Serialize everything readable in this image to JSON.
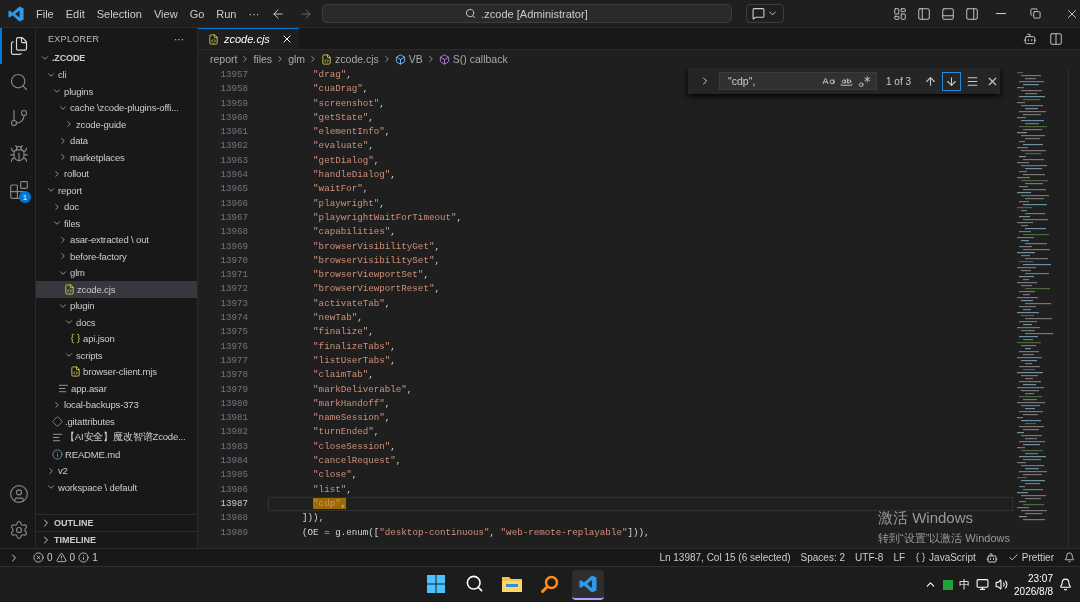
{
  "title_bar": {
    "menus": [
      "File",
      "Edit",
      "Selection",
      "View",
      "Go",
      "Run",
      "···"
    ],
    "command_center": ".zcode [Administrator]"
  },
  "activity_bar": {
    "items": [
      {
        "kind": "explorer",
        "selected": true
      },
      {
        "kind": "search",
        "selected": false
      },
      {
        "kind": "source-control",
        "selected": false
      },
      {
        "kind": "run",
        "selected": false
      },
      {
        "kind": "extensions",
        "selected": false,
        "badge": "1"
      }
    ],
    "bottom": [
      {
        "kind": "account"
      },
      {
        "kind": "settings"
      }
    ]
  },
  "sidebar": {
    "title": "EXPLORER",
    "more": "···",
    "root": {
      "label": ".ZCODE",
      "kind": "folder",
      "expanded": true,
      "selected": false,
      "children": [
        {
          "label": "cli",
          "kind": "folder",
          "expanded": true,
          "selected": false,
          "children": [
            {
              "label": "plugins",
              "kind": "folder",
              "expanded": true,
              "selected": false,
              "children": [
                {
                  "label": "cache \\zcode-plugins-offi...",
                  "kind": "folder",
                  "expanded": true,
                  "selected": false,
                  "children": [
                    {
                      "label": "zcode-guide",
                      "kind": "folder",
                      "expanded": false,
                      "selected": false
                    }
                  ]
                },
                {
                  "label": "data",
                  "kind": "folder",
                  "expanded": false,
                  "selected": false
                },
                {
                  "label": "marketplaces",
                  "kind": "folder",
                  "expanded": false,
                  "selected": false
                }
              ]
            },
            {
              "label": "rollout",
              "kind": "folder",
              "expanded": false,
              "selected": false
            }
          ]
        },
        {
          "label": "report",
          "kind": "folder",
          "expanded": true,
          "selected": false,
          "children": [
            {
              "label": "doc",
              "kind": "folder",
              "expanded": false,
              "selected": false
            },
            {
              "label": "files",
              "kind": "folder",
              "expanded": true,
              "selected": false,
              "children": [
                {
                  "label": "asar-extracted \\ out",
                  "kind": "folder",
                  "expanded": false,
                  "selected": false
                },
                {
                  "label": "before-factory",
                  "kind": "folder",
                  "expanded": false,
                  "selected": false
                },
                {
                  "label": "glm",
                  "kind": "folder",
                  "expanded": true,
                  "selected": false,
                  "children": [
                    {
                      "label": "zcode.cjs",
                      "kind": "js",
                      "selected": true
                    }
                  ]
                },
                {
                  "label": "plugin",
                  "kind": "folder",
                  "expanded": true,
                  "selected": false,
                  "children": [
                    {
                      "label": "docs",
                      "kind": "folder",
                      "expanded": true,
                      "selected": false,
                      "children": [
                        {
                          "label": "api.json",
                          "kind": "json",
                          "selected": false
                        }
                      ]
                    },
                    {
                      "label": "scripts",
                      "kind": "folder",
                      "expanded": true,
                      "selected": false,
                      "children": [
                        {
                          "label": "browser-client.mjs",
                          "kind": "js",
                          "selected": false
                        }
                      ]
                    }
                  ]
                },
                {
                  "label": "app.asar",
                  "kind": "file",
                  "selected": false
                }
              ]
            },
            {
              "label": "local-backups-373",
              "kind": "folder",
              "expanded": false,
              "selected": false
            },
            {
              "label": ".gitattributes",
              "kind": "git",
              "selected": false
            },
            {
              "label": "【AI安全】魔改智谱Zcode...",
              "kind": "file",
              "selected": false
            },
            {
              "label": "README.md",
              "kind": "info",
              "selected": false
            }
          ]
        },
        {
          "label": "v2",
          "kind": "folder",
          "expanded": false,
          "selected": false
        },
        {
          "label": "workspace \\ default",
          "kind": "folder",
          "expanded": true,
          "selected": false
        }
      ]
    },
    "sections": [
      {
        "label": "OUTLINE",
        "expanded": false
      },
      {
        "label": "TIMELINE",
        "expanded": false
      }
    ]
  },
  "tabs": [
    {
      "label": "zcode.cjs",
      "kind": "js",
      "selected": true,
      "preview": true
    }
  ],
  "breadcrumbs": [
    {
      "label": "report",
      "kind": "folder"
    },
    {
      "label": "files",
      "kind": "folder"
    },
    {
      "label": "glm",
      "kind": "folder"
    },
    {
      "label": "zcode.cjs",
      "kind": "js"
    },
    {
      "label": "VB",
      "kind": "variable"
    },
    {
      "label": "S() callback",
      "kind": "method"
    }
  ],
  "find_widget": {
    "value": "\"cdp\",",
    "options": [
      {
        "kind": "match-case",
        "on": false
      },
      {
        "kind": "whole-word",
        "on": false
      },
      {
        "kind": "regex",
        "on": false
      }
    ],
    "result": "1 of 3"
  },
  "editor": {
    "lines": [
      {
        "number": "13957",
        "text": "        \"drag\",",
        "selected": false
      },
      {
        "number": "13958",
        "text": "        \"cuaDrag\",",
        "selected": false
      },
      {
        "number": "13959",
        "text": "        \"screenshot\",",
        "selected": false
      },
      {
        "number": "13960",
        "text": "        \"getState\",",
        "selected": false
      },
      {
        "number": "13961",
        "text": "        \"elementInfo\",",
        "selected": false
      },
      {
        "number": "13962",
        "text": "        \"evaluate\",",
        "selected": false
      },
      {
        "number": "13963",
        "text": "        \"getDialog\",",
        "selected": false
      },
      {
        "number": "13964",
        "text": "        \"handleDialog\",",
        "selected": false
      },
      {
        "number": "13965",
        "text": "        \"waitFor\",",
        "selected": false
      },
      {
        "number": "13966",
        "text": "        \"playwright\",",
        "selected": false
      },
      {
        "number": "13967",
        "text": "        \"playwrightWaitForTimeout\",",
        "selected": false
      },
      {
        "number": "13968",
        "text": "        \"capabilities\",",
        "selected": false
      },
      {
        "number": "13969",
        "text": "        \"browserVisibilityGet\",",
        "selected": false
      },
      {
        "number": "13970",
        "text": "        \"browserVisibilitySet\",",
        "selected": false
      },
      {
        "number": "13971",
        "text": "        \"browserViewportSet\",",
        "selected": false
      },
      {
        "number": "13972",
        "text": "        \"browserViewportReset\",",
        "selected": false
      },
      {
        "number": "13973",
        "text": "        \"activateTab\",",
        "selected": false
      },
      {
        "number": "13974",
        "text": "        \"newTab\",",
        "selected": false
      },
      {
        "number": "13975",
        "text": "        \"finalize\",",
        "selected": false
      },
      {
        "number": "13976",
        "text": "        \"finalizeTabs\",",
        "selected": false
      },
      {
        "number": "13977",
        "text": "        \"listUserTabs\",",
        "selected": false
      },
      {
        "number": "13978",
        "text": "        \"claimTab\",",
        "selected": false
      },
      {
        "number": "13979",
        "text": "        \"markDeliverable\",",
        "selected": false
      },
      {
        "number": "13980",
        "text": "        \"markHandoff\",",
        "selected": false
      },
      {
        "number": "13981",
        "text": "        \"nameSession\",",
        "selected": false
      },
      {
        "number": "13982",
        "text": "        \"turnEnded\",",
        "selected": false
      },
      {
        "number": "13983",
        "text": "        \"closeSession\",",
        "selected": false
      },
      {
        "number": "13984",
        "text": "        \"cancelRequest\",",
        "selected": false
      },
      {
        "number": "13985",
        "text": "        \"close\",",
        "selected": false
      },
      {
        "number": "13986",
        "text": "        \"list\",",
        "selected": false
      },
      {
        "number": "13987",
        "text": "        \"cdp\",",
        "selected": true
      },
      {
        "number": "13988",
        "text": "      ])),",
        "selected": false
      },
      {
        "number": "13989",
        "text": "      (OE = g.enum([\"desktop-continuous\", \"web-remote-replayable\"])),",
        "selected": false
      }
    ]
  },
  "activation_notice": {
    "title": "激活 Windows",
    "subtitle": "转到“设置”以激活 Windows"
  },
  "status_bar": {
    "problems": [
      {
        "kind": "error",
        "count": "0"
      },
      {
        "kind": "warning",
        "count": "0"
      },
      {
        "kind": "info",
        "count": "1"
      }
    ],
    "items": [
      {
        "kind": "text",
        "label": "Ln 13987, Col 15 (6 selected)"
      },
      {
        "kind": "text",
        "label": "Spaces: 2"
      },
      {
        "kind": "text",
        "label": "UTF-8"
      },
      {
        "kind": "text",
        "label": "LF"
      },
      {
        "kind": "language",
        "label": "JavaScript"
      },
      {
        "kind": "copilot"
      },
      {
        "kind": "formatter",
        "label": "Prettier"
      },
      {
        "kind": "notifications"
      }
    ]
  },
  "taskbar": {
    "apps": [
      {
        "kind": "start",
        "selected": false
      },
      {
        "kind": "search",
        "selected": false
      },
      {
        "kind": "files",
        "selected": false
      },
      {
        "kind": "finder",
        "selected": false
      },
      {
        "kind": "vscode",
        "selected": true
      }
    ],
    "tray": {
      "input_method": "中",
      "time": "23:07",
      "date": "2026/8/8"
    }
  }
}
